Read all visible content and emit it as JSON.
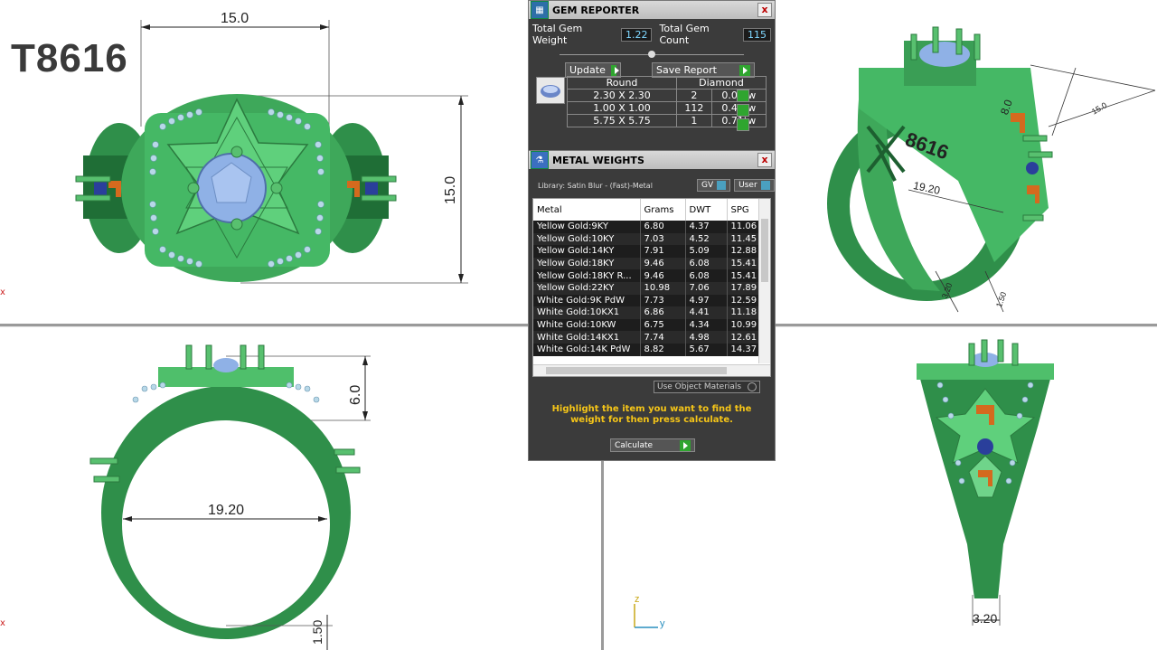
{
  "model_label": "T8616",
  "dimensions": {
    "top_width": "15.0",
    "top_height": "15.0",
    "front_height": "6.0",
    "front_inner": "19.20",
    "front_bottom": "1.50",
    "persp_1": "8.0",
    "persp_2": "15.0",
    "persp_3": "19.20",
    "persp_4": "3.20",
    "persp_5": "1.50",
    "persp_text": "8616",
    "side_bottom": "3.20"
  },
  "axis": {
    "z": "z",
    "y": "y"
  },
  "viewport_marks": {
    "top_left": "x",
    "bottom_left": "x"
  },
  "gem_reporter": {
    "title": "GEM REPORTER",
    "close": "x",
    "total_weight_label": "Total Gem Weight",
    "total_weight_value": "1.22",
    "total_count_label": "Total Gem Count",
    "total_count_value": "115",
    "update_label": "Update",
    "save_label": "Save Report",
    "table_header_shape": "Round",
    "table_header_type": "Diamond",
    "rows": [
      {
        "size": "2.30 X 2.30",
        "count": "2",
        "weight": "0.09tw"
      },
      {
        "size": "1.00 X 1.00",
        "count": "112",
        "weight": "0.42tw"
      },
      {
        "size": "5.75 X 5.75",
        "count": "1",
        "weight": "0.71tw"
      }
    ]
  },
  "metal_weights": {
    "title": "METAL WEIGHTS",
    "close": "x",
    "library": "Library: Satin Blur - (Fast)-Metal",
    "gv_label": "GV",
    "user_label": "User",
    "columns": [
      "Metal",
      "Grams",
      "DWT",
      "SPG"
    ],
    "rows": [
      [
        "Yellow Gold:9KY",
        "6.80",
        "4.37",
        "11.06"
      ],
      [
        "Yellow Gold:10KY",
        "7.03",
        "4.52",
        "11.45"
      ],
      [
        "Yellow Gold:14KY",
        "7.91",
        "5.09",
        "12.88"
      ],
      [
        "Yellow Gold:18KY",
        "9.46",
        "6.08",
        "15.41"
      ],
      [
        "Yellow Gold:18KY R...",
        "9.46",
        "6.08",
        "15.41"
      ],
      [
        "Yellow Gold:22KY",
        "10.98",
        "7.06",
        "17.89"
      ],
      [
        "White Gold:9K PdW",
        "7.73",
        "4.97",
        "12.59"
      ],
      [
        "White Gold:10KX1",
        "6.86",
        "4.41",
        "11.18"
      ],
      [
        "White Gold:10KW",
        "6.75",
        "4.34",
        "10.99"
      ],
      [
        "White Gold:14KX1",
        "7.74",
        "4.98",
        "12.61"
      ],
      [
        "White Gold:14K PdW",
        "8.82",
        "5.67",
        "14.37"
      ]
    ],
    "use_object_materials": "Use Object Materials",
    "hint": "Highlight the item you want to find the weight for then press calculate.",
    "calculate_label": "Calculate"
  }
}
